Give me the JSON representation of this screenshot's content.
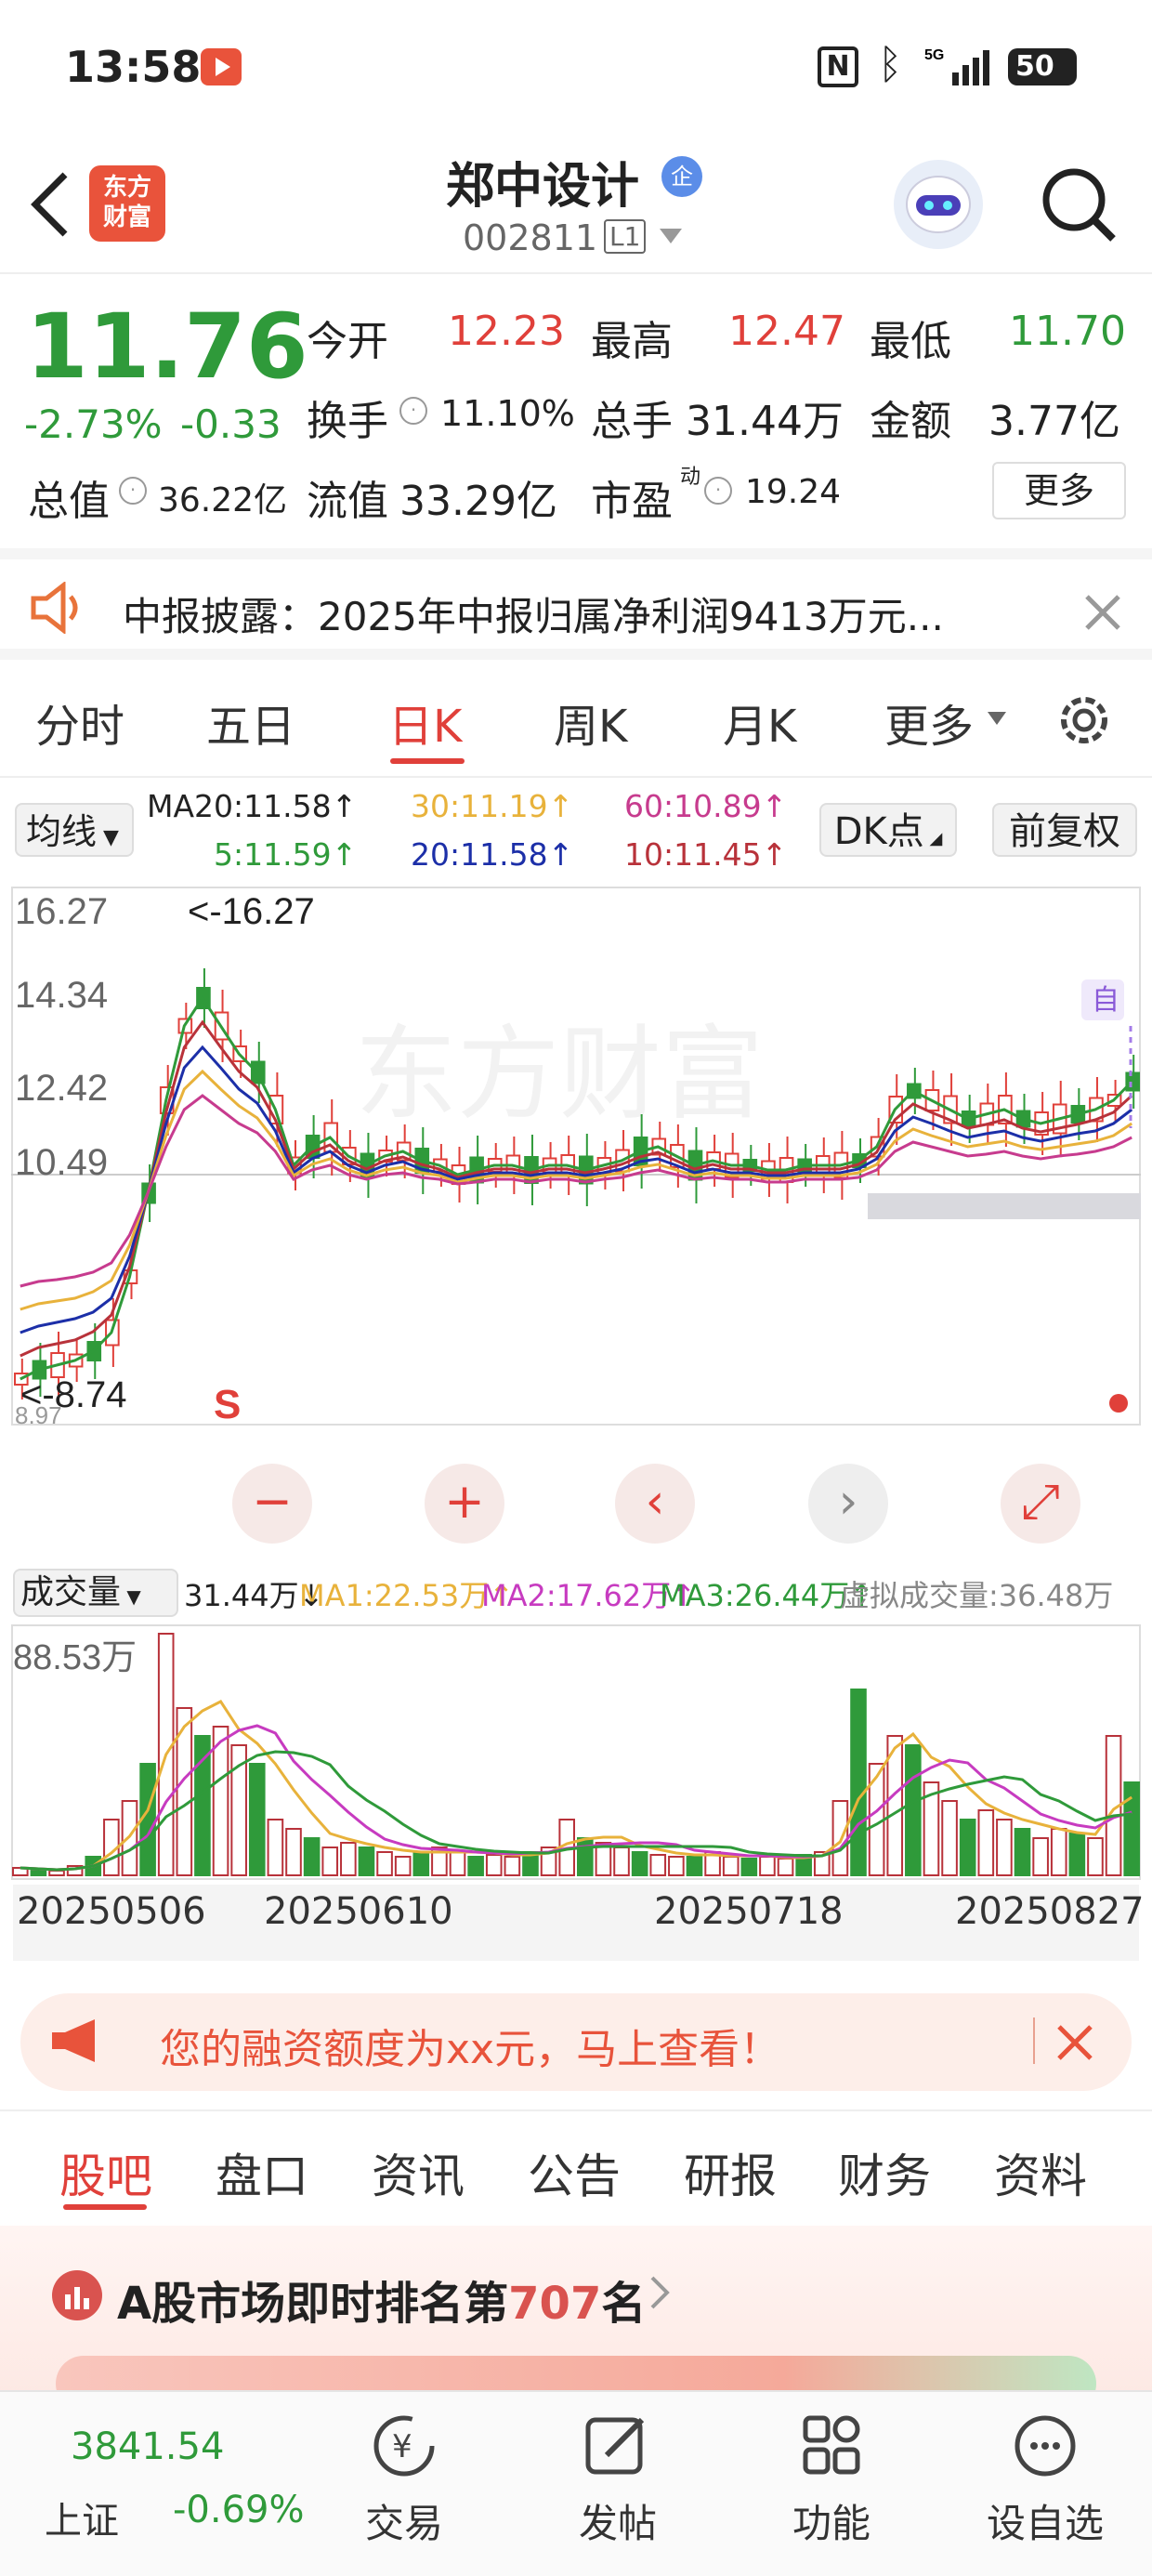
{
  "status": {
    "time": "13:58",
    "battery": "50"
  },
  "header": {
    "logo_line1": "东方",
    "logo_line2": "财富",
    "stock_name": "郑中设计",
    "badge": "企",
    "code": "002811",
    "level": "L1"
  },
  "quote": {
    "price": "11.76",
    "chg_pct": "-2.73%",
    "chg": "-0.33",
    "open_label": "今开",
    "open": "12.23",
    "high_label": "最高",
    "high": "12.47",
    "low_label": "最低",
    "low": "11.70",
    "turnover_label": "换手",
    "turnover": "11.10%",
    "volume_label": "总手",
    "volume": "31.44万",
    "amount_label": "金额",
    "amount": "3.77亿",
    "mcap_label": "总值",
    "mcap": "36.22亿",
    "float_label": "流值",
    "float": "33.29亿",
    "pe_label": "市盈",
    "pe_sup": "动",
    "pe": "19.24",
    "more_btn": "更多"
  },
  "notice": {
    "text": "中报披露：2025年中报归属净利润9413万元..."
  },
  "tabs": [
    "分时",
    "五日",
    "日K",
    "周K",
    "月K",
    "更多"
  ],
  "active_tab": "日K",
  "ma": {
    "selector": "均线",
    "ma20a": "MA20:11.58↑",
    "ma30": "30:11.19↑",
    "ma60": "60:10.89↑",
    "ma5": "5:11.59↑",
    "ma20b": "20:11.58↑",
    "ma10": "10:11.45↑",
    "dk": "DK点",
    "adjust": "前复权"
  },
  "kchart": {
    "y_labels": [
      "16.27",
      "14.34",
      "12.42",
      "10.49"
    ],
    "max_marker": "<-16.27",
    "min_marker": "<-8.74",
    "low_label": "8.97",
    "s_mark": "S",
    "watermark": "东方财富",
    "auto": "自"
  },
  "vol": {
    "selector": "成交量",
    "v": "31.44万↓",
    "ma1": "MA1:22.53万↑",
    "ma2": "MA2:17.62万↑",
    "ma3": "MA3:26.44万↑",
    "virtual": "虚拟成交量:36.48万",
    "ymax": "88.53万"
  },
  "dates": [
    "20250506",
    "20250610",
    "20250718",
    "20250827"
  ],
  "chart_data": {
    "type": "candlestick",
    "ylim": [
      8.74,
      16.27
    ],
    "max": 16.27,
    "min": 8.74,
    "volume_ylim": [
      0,
      88.53
    ],
    "volume_unit": "万",
    "ma_last": {
      "MA5": 11.59,
      "MA10": 11.45,
      "MA20": 11.58,
      "MA30": 11.19,
      "MA60": 10.89
    }
  },
  "promo": {
    "text": "您的融资额度为xx元，马上查看！"
  },
  "subtabs": [
    "股吧",
    "盘口",
    "资讯",
    "公告",
    "研报",
    "财务",
    "资料"
  ],
  "rank": {
    "prefix": "A股市场即时排名第",
    "num": "707",
    "suffix": "名"
  },
  "bottom": {
    "index_value": "3841.54",
    "index_name": "上证",
    "index_chg": "-0.69%",
    "trade": "交易",
    "post": "发帖",
    "func": "功能",
    "watch": "设自选"
  }
}
